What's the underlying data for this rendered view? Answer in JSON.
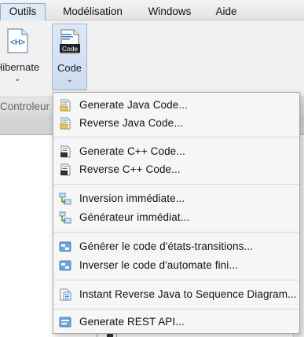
{
  "menubar": {
    "items": [
      {
        "label": "Outils",
        "active": true
      },
      {
        "label": "Modélisation",
        "active": false
      },
      {
        "label": "Windows",
        "active": false
      },
      {
        "label": "Aide",
        "active": false
      }
    ]
  },
  "ribbon": {
    "hibernate_label": "Hibernate",
    "code_label": "Code",
    "code_icon_text": "Code",
    "hibernate_icon_text": "<H>",
    "group_label": "Controleur"
  },
  "dropdown": {
    "items": [
      {
        "label": "Generate Java Code...",
        "icon": "java-icon"
      },
      {
        "label": "Reverse Java Code...",
        "icon": "java-icon"
      },
      {
        "label": "Generate C++ Code...",
        "icon": "cpp-icon"
      },
      {
        "label": "Reverse C++ Code...",
        "icon": "cpp-icon"
      },
      {
        "label": "Inversion immédiate...",
        "icon": "instant-reverse-icon"
      },
      {
        "label": "Générateur immédiat...",
        "icon": "instant-generator-icon"
      },
      {
        "label": "Générer le code d'états-transitions...",
        "icon": "state-machine-icon"
      },
      {
        "label": "Inverser le code d'automate fini...",
        "icon": "state-machine-icon"
      },
      {
        "label": "Instant Reverse Java to Sequence Diagram...",
        "icon": "sequence-diagram-icon"
      },
      {
        "label": "Generate REST API...",
        "icon": "rest-api-icon"
      }
    ]
  },
  "colors": {
    "active_tab": "#dfeaf7",
    "pressed_button": "#cddcef",
    "menu_background": "#f6f6f6",
    "icon_blue": "#3f7cc4",
    "icon_yellow": "#e7c64a"
  }
}
